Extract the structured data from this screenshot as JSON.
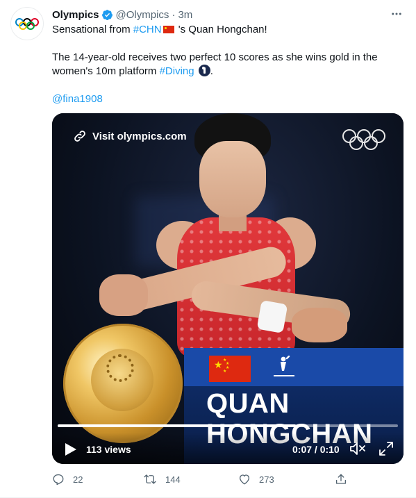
{
  "author": {
    "name": "Olympics",
    "handle": "@Olympics",
    "separator": "·",
    "time": "3m",
    "verified": true
  },
  "tweet": {
    "line1_pre": "Sensational from ",
    "line1_hashtag": "#CHN",
    "line1_flag_emoji": "china-flag",
    "line1_post": " 's Quan Hongchan!",
    "line2_pre": "The 14-year-old receives two perfect 10 scores as she wins gold in the women's 10m platform ",
    "line2_hashtag": "#Diving",
    "line2_emoji": "diving-emoji",
    "line2_post": ".",
    "mention": "@fina1908"
  },
  "media": {
    "visit_label": "Visit olympics.com",
    "athlete_name_line1": "QUAN",
    "athlete_name_line2": "HONGCHAN",
    "views": "113 views",
    "timecode": "0:07 / 0:10",
    "progress": 0.7
  },
  "actions": {
    "replies": "22",
    "retweets": "144",
    "likes": "273"
  },
  "colors": {
    "link": "#1d9bf0",
    "secondary_text": "#536471",
    "verified": "#1d9bf0",
    "banner_blue": "#1a4aa8",
    "banner_dark": "#0e2a63"
  }
}
